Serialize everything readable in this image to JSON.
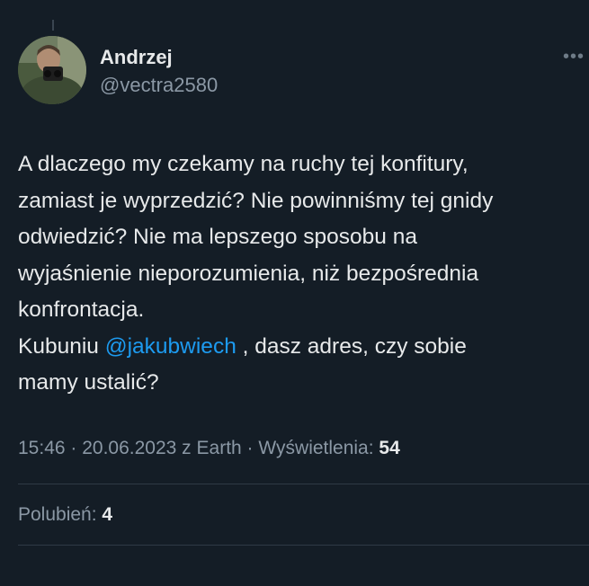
{
  "author": {
    "display_name": "Andrzej",
    "handle": "@vectra2580"
  },
  "more_icon": "more-horizontal-icon",
  "tweet": {
    "lines": [
      "A dlaczego my czekamy na ruchy tej konfitury,",
      "zamiast je wyprzedzić? Nie powinniśmy tej gnidy",
      "odwiedzić? Nie ma lepszego sposobu na",
      "wyjaśnienie nieporozumienia, niż bezpośrednia",
      "konfrontacja."
    ],
    "mention_line": {
      "before": "Kubuniu ",
      "mention": "@jakubwiech",
      "after": " , dasz adres, czy sobie"
    },
    "last_line": "mamy ustalić?"
  },
  "meta": {
    "time": "15:46",
    "separator": " · ",
    "date": "20.06.2023",
    "source": " z Earth",
    "views_label": "Wyświetlenia: ",
    "views_count": "54"
  },
  "likes": {
    "label": "Polubień: ",
    "count": "4"
  },
  "colors": {
    "background": "#141d26",
    "text": "#e7e9ea",
    "secondary_text": "#8b98a5",
    "mention": "#1d9bf0",
    "divider": "#2f3a45"
  }
}
